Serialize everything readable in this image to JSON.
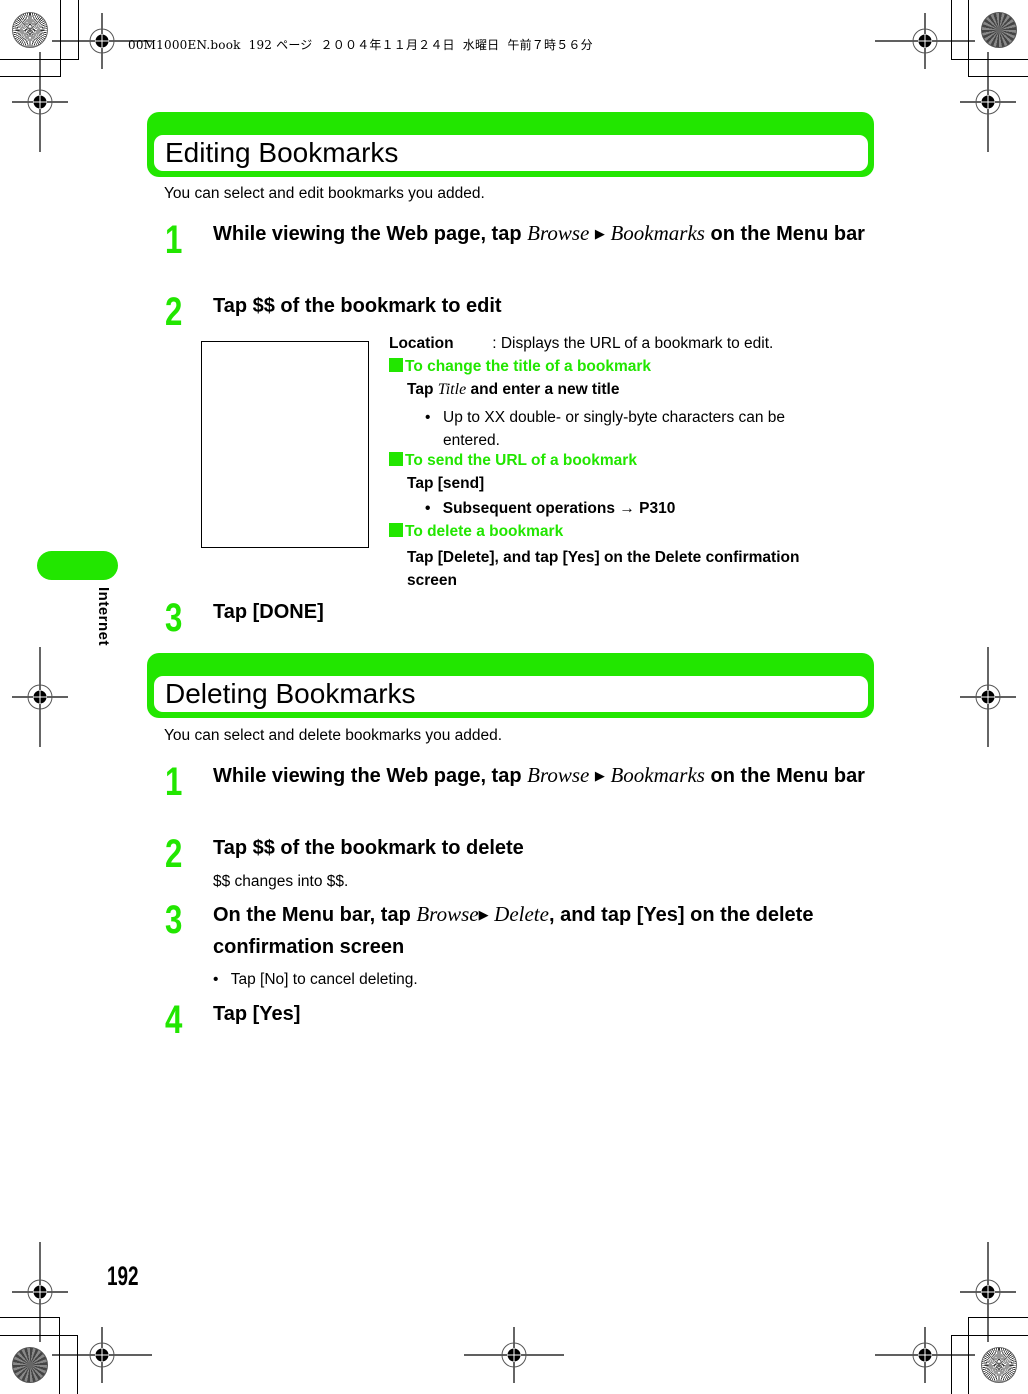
{
  "print_header": {
    "text": "00M1000EN.book  192 ページ  ２００４年１１月２４日  水曜日  午前７時５６分"
  },
  "side_tab": {
    "label": "Internet"
  },
  "page_number": "192",
  "colors": {
    "accent": "#22e600",
    "text": "#000000"
  },
  "sections": [
    {
      "title": "Editing Bookmarks",
      "intro": "You can select and edit bookmarks you added.",
      "steps": [
        {
          "num": "1",
          "text_before": "While viewing the Web page, tap ",
          "menu1": "Browse",
          "arrow": "▶",
          "menu2": "Bookmarks",
          "text_after": " on the Menu bar"
        },
        {
          "num": "2",
          "text": "Tap $$ of the bookmark to edit"
        },
        {
          "num": "3",
          "text": "Tap [DONE]"
        }
      ],
      "detail": {
        "location_label": "Location",
        "location_desc": ":  Displays the URL of a bookmark to edit.",
        "subsections": [
          {
            "heading": "To change the title of a bookmark",
            "action_prefix": "Tap ",
            "action_italic": "Title",
            "action_suffix": " and enter a new title",
            "bullet": "Up to XX double- or singly-byte characters can be entered."
          },
          {
            "heading": "To send the URL of a bookmark",
            "action": "Tap [send]",
            "bullet_prefix": "Subsequent operations ",
            "bullet_arrow": "→",
            "bullet_ref": " P310"
          },
          {
            "heading": "To delete a bookmark",
            "action": "Tap [Delete], and tap [Yes] on the Delete confirmation screen"
          }
        ]
      }
    },
    {
      "title": "Deleting Bookmarks",
      "intro": "You can select and delete bookmarks you added.",
      "steps": [
        {
          "num": "1",
          "text_before": "While viewing the Web page, tap ",
          "menu1": "Browse",
          "arrow": "▶",
          "menu2": "Bookmarks",
          "text_after": " on the Menu bar"
        },
        {
          "num": "2",
          "text": "Tap $$ of the bookmark to delete",
          "note": "$$ changes into $$."
        },
        {
          "num": "3",
          "text_before": "On the Menu bar, tap ",
          "menu1": "Browse",
          "arrow": "▶",
          "menu2": "Delete",
          "text_after": ", and tap [Yes] on the delete confirmation screen",
          "bullet": "Tap [No] to cancel deleting."
        },
        {
          "num": "4",
          "text": "Tap [Yes]"
        }
      ]
    }
  ]
}
